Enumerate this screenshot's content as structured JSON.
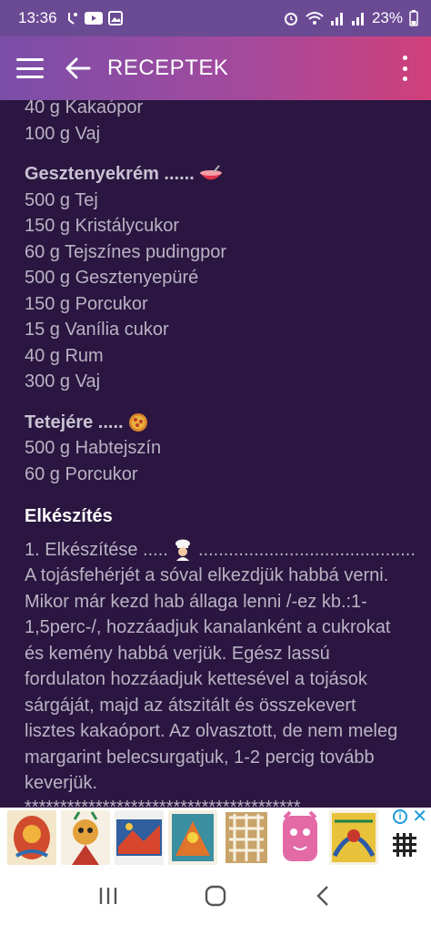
{
  "status_bar": {
    "time": "13:36",
    "battery": "23%"
  },
  "app_bar": {
    "title": "RECEPTEK"
  },
  "recipe": {
    "intro_lines": [
      "40 g Kakaópor",
      "100 g Vaj"
    ],
    "sections": [
      {
        "heading": "Gesztenyekrém ......",
        "emoji": "bowl",
        "items": [
          "500 g Tej",
          "150 g Kristálycukor",
          "60 g Tejszínes pudingpor",
          "500 g Gesztenyepüré",
          "150 g Porcukor",
          "15 g Vanília cukor",
          "40 g Rum",
          "300 g Vaj"
        ]
      },
      {
        "heading": "Tetejére .....",
        "emoji": "pizza",
        "items": [
          "500 g Habtejszín",
          "60 g Porcukor"
        ]
      }
    ],
    "method_heading": "Elkészítés",
    "step_label": "1. Elkészítése .....",
    "step_dots": "...........................................",
    "step_text": "A tojásfehérjét a sóval elkezdjük habbá verni. Mikor már kezd hab állaga lenni /-ez kb.:1- 1,5perc-/, hozzáadjuk kanalanként a cukrokat és kemény habbá verjük. Egész lassú fordulaton hozzáadjuk kettesével a tojások sárgáját, majd az átszitált és összekevert lisztes kakaóport. Az olvasztott, de nem meleg margarint belecsurgatjuk, 1-2 percig tovább keverjük.",
    "separator": "***************************************"
  },
  "colors": {
    "background": "#2a1640",
    "text": "#b9b3c4",
    "appbar_start": "#7a4ea8",
    "appbar_end": "#d0407a"
  },
  "icons": {
    "menu": "hamburger-icon",
    "back": "arrow-left-icon",
    "more": "more-vertical-icon"
  }
}
